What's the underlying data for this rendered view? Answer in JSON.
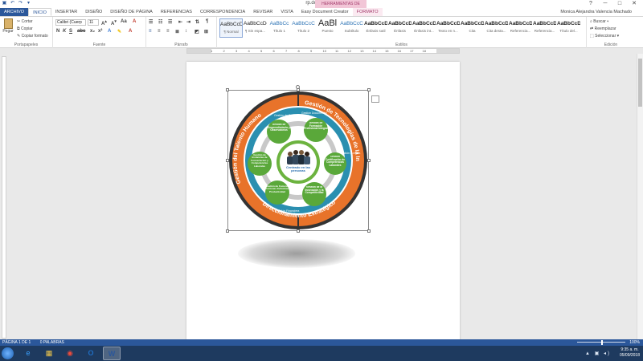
{
  "window": {
    "title": "rp.docx - Word",
    "context_tab_header": "HERRAMIENTAS DE IMAGEN",
    "controls": [
      "?",
      "─",
      "□",
      "✕"
    ]
  },
  "tabs": [
    {
      "label": "ARCHIVO",
      "kind": "file"
    },
    {
      "label": "INICIO",
      "kind": "active"
    },
    {
      "label": "INSERTAR",
      "kind": "normal"
    },
    {
      "label": "DISEÑO",
      "kind": "normal"
    },
    {
      "label": "DISEÑO DE PÁGINA",
      "kind": "normal"
    },
    {
      "label": "REFERENCIAS",
      "kind": "normal"
    },
    {
      "label": "CORRESPONDENCIA",
      "kind": "normal"
    },
    {
      "label": "REVISAR",
      "kind": "normal"
    },
    {
      "label": "VISTA",
      "kind": "normal"
    },
    {
      "label": "Easy Document Creator",
      "kind": "normal"
    },
    {
      "label": "FORMATO",
      "kind": "ctx"
    }
  ],
  "user": "Monica Alejandra Valencia Machado",
  "ribbon": {
    "clipboard": {
      "paste": "Pegar",
      "cut": "Cortar",
      "copy": "Copiar",
      "format_painter": "Copiar formato",
      "label": "Portapapeles"
    },
    "font": {
      "name": "Calibri (Cuerp",
      "size": "11",
      "label": "Fuente"
    },
    "paragraph": {
      "label": "Párrafo"
    },
    "styles": {
      "label": "Estilos",
      "items": [
        {
          "preview": "AaBbCcDc",
          "name": "¶ Normal",
          "selected": true
        },
        {
          "preview": "AaBbCcDc",
          "name": "¶ Sin espa...",
          "selected": false
        },
        {
          "preview": "AaBbCc",
          "name": "Título 1",
          "selected": false
        },
        {
          "preview": "AaBbCcC",
          "name": "Título 2",
          "selected": false
        },
        {
          "preview": "AaBl",
          "name": "Puesto",
          "selected": false
        },
        {
          "preview": "AaBbCcC",
          "name": "Subtítulo",
          "selected": false
        },
        {
          "preview": "AaBbCcDc",
          "name": "Énfasis sutil",
          "selected": false
        },
        {
          "preview": "AaBbCcDc",
          "name": "Énfasis",
          "selected": false
        },
        {
          "preview": "AaBbCcDc",
          "name": "Énfasis int...",
          "selected": false
        },
        {
          "preview": "AaBbCcDc",
          "name": "Texto en n...",
          "selected": false
        },
        {
          "preview": "AaBbCcDc",
          "name": "Cita",
          "selected": false
        },
        {
          "preview": "AaBbCcDc",
          "name": "Cita desta...",
          "selected": false
        },
        {
          "preview": "AaBbCcDc",
          "name": "Referencia...",
          "selected": false
        },
        {
          "preview": "AaBbCcDc",
          "name": "Referencia...",
          "selected": false
        },
        {
          "preview": "AaBbCcDc",
          "name": "Título del...",
          "selected": false
        }
      ]
    },
    "editing": {
      "find": "Buscar",
      "replace": "Reemplazar",
      "select": "Seleccionar",
      "label": "Edición"
    }
  },
  "ruler_numbers": [
    "1",
    "2",
    "3",
    "4",
    "5",
    "6",
    "7",
    "8",
    "9",
    "10",
    "11",
    "12",
    "13",
    "14",
    "15",
    "16",
    "17",
    "18"
  ],
  "diagram": {
    "outer_top_right": "Gestión de Tecnologías de la Información",
    "outer_left": "Gestión del Talento Humano",
    "outer_bottom": "Direccionamiento Estratégico",
    "center": "Centrado en las personas",
    "nodes": [
      "Gestión de Emprendimiento y Observatorios",
      "Gestión de Formación Profesional Integral",
      "Gestión Certificación de Competencias Laborales",
      "Gestión de la Innovación y la Competitividad",
      "Gestión de Instancias de Concertación y Competencias Laborales",
      "Gestión de Fomento Acciones Inclusivas Productividad"
    ],
    "ring_labels": [
      "Gestión de Comunicaciones",
      "Gestión Documental",
      "Gestión Jurídica",
      "Gestión Financiera"
    ]
  },
  "status": {
    "page": "PÁGINA 1 DE 1",
    "words": "0 PALABRAS",
    "zoom": "100%"
  },
  "taskbar": {
    "apps": [
      {
        "icon": "internet-explorer-icon",
        "glyph": "e",
        "color": "#3aa0ff",
        "active": false
      },
      {
        "icon": "folder-icon",
        "glyph": "▦",
        "color": "#f2c94c",
        "active": false
      },
      {
        "icon": "chrome-icon",
        "glyph": "◉",
        "color": "#e94b3c",
        "active": false
      },
      {
        "icon": "outlook-icon",
        "glyph": "O",
        "color": "#1f6dc2",
        "active": false
      },
      {
        "icon": "word-icon",
        "glyph": "W",
        "color": "#2b579a",
        "active": true
      }
    ],
    "time": "9:35 a. m.",
    "date": "05/09/2018"
  }
}
